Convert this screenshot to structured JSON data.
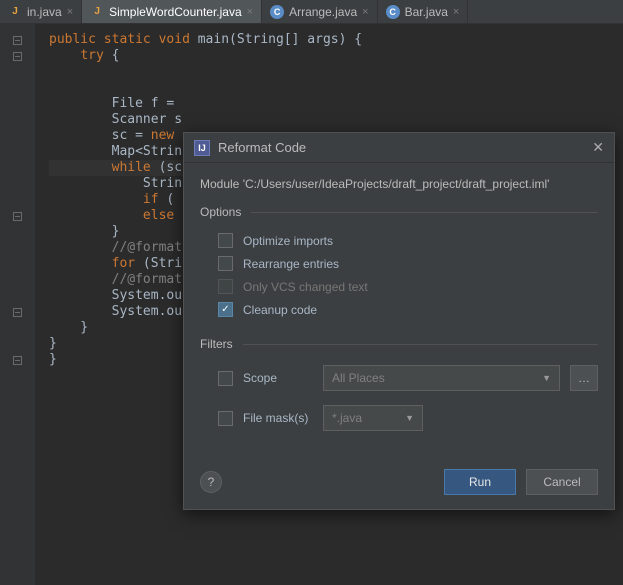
{
  "tabs": [
    {
      "label": "in.java",
      "type": "j"
    },
    {
      "label": "SimpleWordCounter.java",
      "type": "j",
      "active": true
    },
    {
      "label": "Arrange.java",
      "type": "c"
    },
    {
      "label": "Bar.java",
      "type": "c"
    }
  ],
  "code": {
    "l1a": "public",
    "l1b": "static",
    "l1c": "void",
    "l1d": " main(String[] args) {",
    "l2a": "try",
    "l2b": " {",
    "l3": "",
    "l4": "",
    "l5": "        File f = ",
    "l6": "        Scanner s",
    "l7a": "        sc = ",
    "l7b": "new",
    "l8": "        Map<Strin",
    "l9a": "while",
    "l9b": " (sc",
    "l10": "            Strin",
    "l11a": "if",
    "l11b": " (",
    "l12a": "else",
    "l13": "        }",
    "l14": "        //@format",
    "l15a": "for",
    "l15b": " (Stri",
    "l16": "        //@format",
    "l17": "        System.ou",
    "l18": "        System.ou",
    "l19": "    }",
    "l20": "}",
    "l21": "}"
  },
  "dialog": {
    "title": "Reformat Code",
    "module": "Module 'C:/Users/user/IdeaProjects/draft_project/draft_project.iml'",
    "optionsLabel": "Options",
    "opt1": "Optimize imports",
    "opt2": "Rearrange entries",
    "opt3": "Only VCS changed text",
    "opt4": "Cleanup code",
    "filtersLabel": "Filters",
    "scope": "Scope",
    "scopePlaceholder": "All Places",
    "fileMask": "File mask(s)",
    "fileMaskValue": "*.java",
    "run": "Run",
    "cancel": "Cancel"
  }
}
